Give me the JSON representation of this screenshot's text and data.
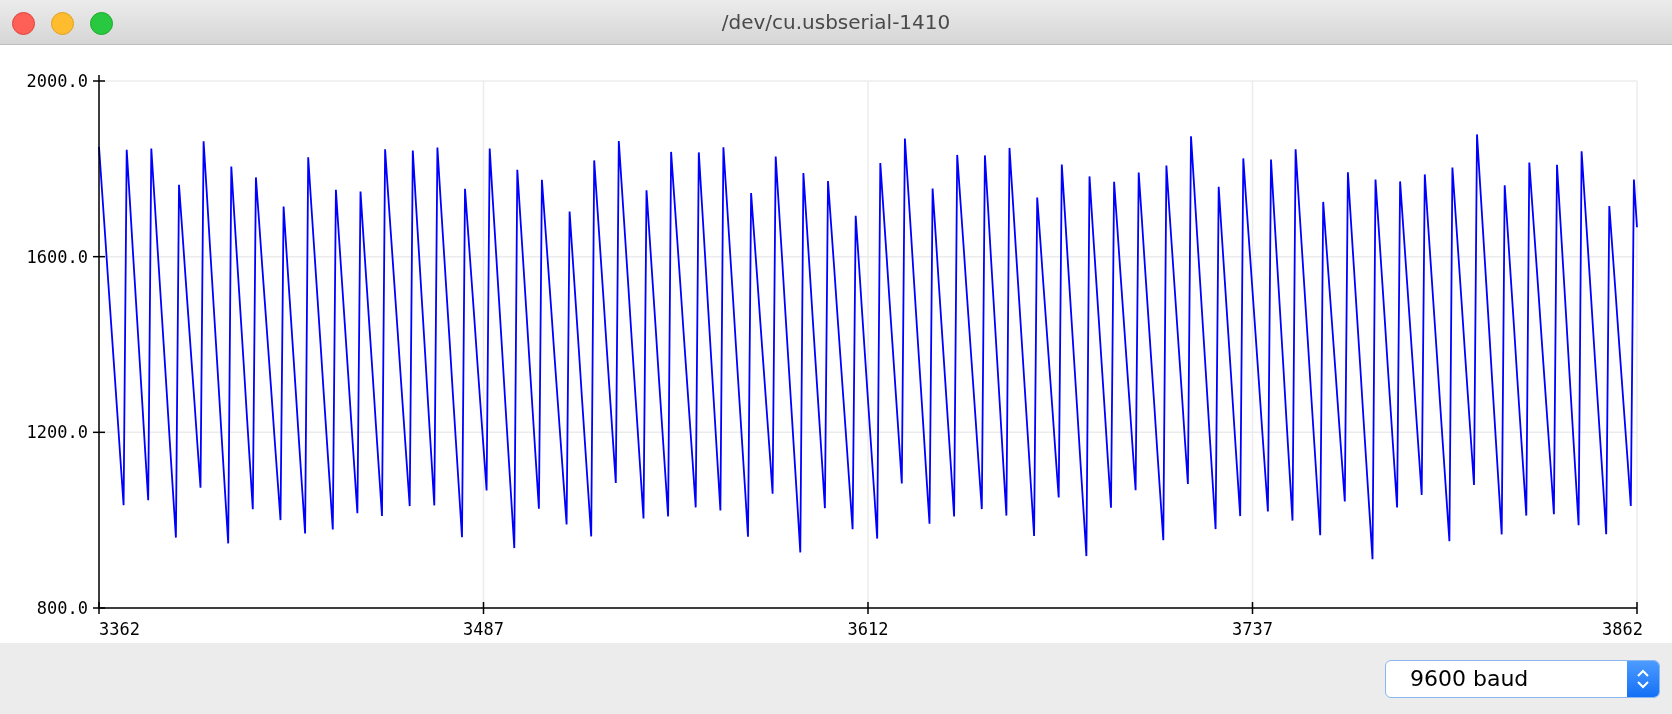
{
  "window": {
    "title": "/dev/cu.usbserial-1410"
  },
  "plot": {
    "y_tick_labels": [
      "2000.0",
      "1600.0",
      "1200.0",
      "800.0"
    ],
    "x_tick_labels": [
      "3362",
      "3487",
      "3612",
      "3737",
      "3862"
    ]
  },
  "baud_select": {
    "value": "9600 baud"
  }
}
